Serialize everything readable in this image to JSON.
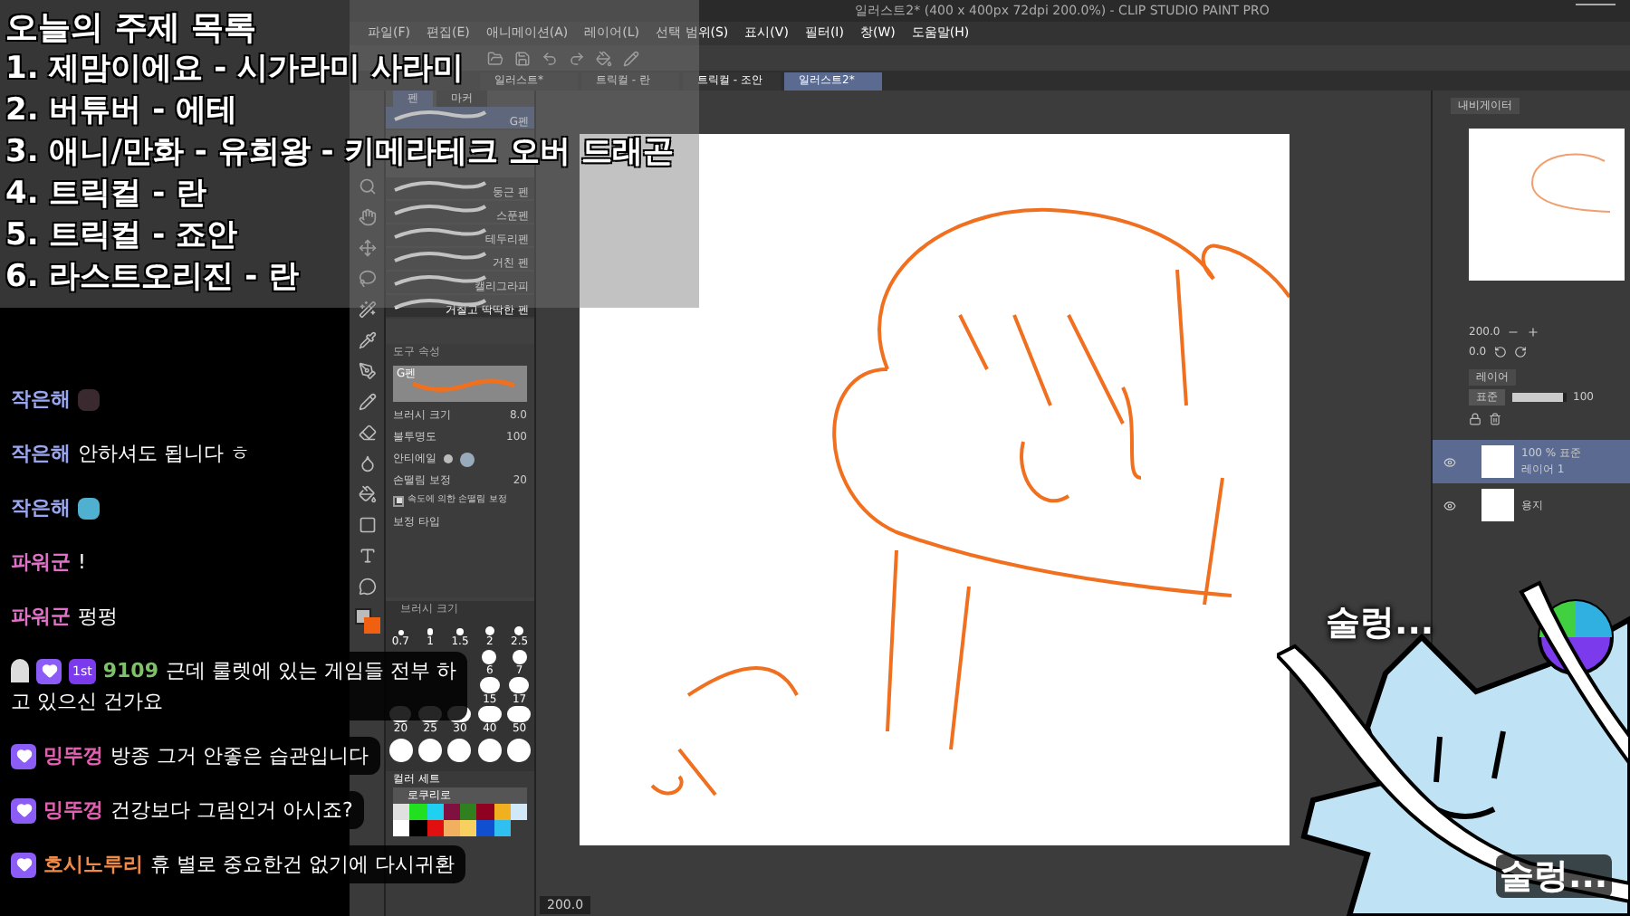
{
  "topics": {
    "title": "오늘의 주제 목록",
    "items": [
      "1.  제맘이에요 - 시가라미 사라미",
      "2. 버튜버 - 에테",
      "3. 애니/만화 - 유희왕 - 키메라테크 오버 드래곤",
      "4. 트릭컬 - 란",
      "5. 트릭컬 - 죠안",
      "6. 라스트오리진 - 란"
    ]
  },
  "app": {
    "title": "일러스트2* (400 x 400px 72dpi 200.0%) - CLIP STUDIO PAINT PRO",
    "menu": [
      "파일(F)",
      "편집(E)",
      "애니메이션(A)",
      "레이어(L)",
      "선택 범위(S)",
      "표시(V)",
      "필터(I)",
      "창(W)",
      "도움말(H)"
    ],
    "doc_tabs": [
      {
        "label": "일러스트*",
        "selected": false
      },
      {
        "label": "트릭컬 - 란",
        "selected": false
      },
      {
        "label": "트릭컬 - 조안",
        "selected": false
      },
      {
        "label": "일러스트2*",
        "selected": true
      }
    ],
    "subtool_tabs": [
      {
        "label": "펜",
        "selected": true
      },
      {
        "label": "마커",
        "selected": false
      }
    ],
    "brushes": [
      {
        "name": "G펜",
        "selected": true
      },
      {
        "name": "둥근 펜",
        "selected": false
      },
      {
        "name": "스푼펜",
        "selected": false
      },
      {
        "name": "테두리펜",
        "selected": false
      },
      {
        "name": "거친 펜",
        "selected": false
      },
      {
        "name": "캘리그라피",
        "selected": false
      },
      {
        "name": "거칠고 딱딱한 펜",
        "selected": false
      }
    ],
    "tool_property": {
      "title": "도구 속성",
      "preview_label": "G펜",
      "brush_size": {
        "label": "브러시 크기",
        "value": "8.0"
      },
      "opacity": {
        "label": "불투명도",
        "value": "100"
      },
      "anti_alias_label": "안티에일",
      "stabilization": {
        "label": "손떨림 보정",
        "value": "20"
      },
      "speed_stabilization": {
        "label": "속도에 의한 손떨림 보정",
        "checked": true
      },
      "correction_type_label": "보정 타입"
    },
    "brush_size_panel": {
      "title": "브러시 크기",
      "sizes": [
        {
          "kind": "shown",
          "label": "0.7"
        },
        {
          "kind": "shown",
          "label": "1"
        },
        {
          "kind": "shown",
          "label": "1.5"
        },
        {
          "kind": "shown",
          "label": "2"
        },
        {
          "kind": "shown",
          "label": "2.5"
        },
        {
          "kind": "covered"
        },
        {
          "kind": "covered"
        },
        {
          "kind": "covered"
        },
        {
          "kind": "shown",
          "label": "6"
        },
        {
          "kind": "shown",
          "label": "7"
        },
        {
          "kind": "covered"
        },
        {
          "kind": "covered"
        },
        {
          "kind": "covered"
        },
        {
          "kind": "shown",
          "label": "15"
        },
        {
          "kind": "shown",
          "label": "17"
        },
        {
          "kind": "shown",
          "label": "20"
        },
        {
          "kind": "shown",
          "label": "25"
        },
        {
          "kind": "shown",
          "label": "30"
        },
        {
          "kind": "shown",
          "label": "40"
        },
        {
          "kind": "shown",
          "label": "50"
        }
      ]
    },
    "color_set": {
      "title": "컬러 세트",
      "set_name": "로쿠리로",
      "swatches": [
        {
          "color": "#e0e0e0"
        },
        {
          "color": "#20e020"
        },
        {
          "color": "#20d0f0"
        },
        {
          "color": "#801040"
        },
        {
          "color": "#308020"
        },
        {
          "color": "#900020"
        },
        {
          "color": "#f0b020"
        },
        {
          "color": "#d0e8f8"
        },
        {
          "color": "#ffffff"
        },
        {
          "color": "#000000"
        },
        {
          "color": "#e01010"
        },
        {
          "color": "#f0b060"
        },
        {
          "color": "#f8d060"
        },
        {
          "color": "#1050d0"
        },
        {
          "color": "#30c0f0"
        }
      ]
    },
    "zoom_reading": "200.0",
    "navigator": {
      "tab": "내비게이터",
      "zoom": "200.0",
      "angle": "0.0"
    },
    "layers": {
      "tab": "레이어",
      "blend": "표준",
      "opacity": "100",
      "opacity_slider": {
        "level": 0.95
      },
      "items": [
        {
          "mode": "100 % 표준",
          "name": "레이어 1",
          "selected": true
        },
        {
          "name": "용지",
          "selected": false
        }
      ]
    }
  },
  "chat": [
    {
      "user": "작은해",
      "color": "#9aa6ee",
      "emote": true,
      "faded": true
    },
    {
      "user": "작은해",
      "color": "#9aa6ee",
      "text": "안하셔도 됩니다 ㅎ",
      "emote": false,
      "faded": false
    },
    {
      "user": "작은해",
      "color": "#9aa6ee",
      "emote": true,
      "faded": false
    },
    {
      "user": "파워군",
      "color": "#e070c8",
      "text": "!",
      "emote": false,
      "faded": false
    },
    {
      "user": "파워군",
      "color": "#e070c8",
      "text": "펑펑",
      "emote": false,
      "faded": false
    },
    {
      "user": "9109",
      "color": "#7fc06a",
      "text": "근데 룰렛에 있는 게임들 전부 하고 있으신 건가요",
      "emote": false,
      "faded": false,
      "badges": [
        {
          "kind": "figure"
        },
        {
          "kind": "heart"
        },
        {
          "kind": "tier",
          "label": "1st"
        }
      ]
    },
    {
      "user": "밍뚜껑",
      "color": "#e060b0",
      "text": "방종 그거 안좋은 습관입니다",
      "emote": false,
      "faded": false,
      "badges": [
        {
          "kind": "heart"
        }
      ]
    },
    {
      "user": "밍뚜껑",
      "color": "#e060b0",
      "text": "건강보다 그림인거 아시죠?",
      "emote": false,
      "faded": false,
      "badges": [
        {
          "kind": "heart"
        }
      ]
    },
    {
      "user": "호시노루리",
      "color": "#f08a48",
      "text": "휴 별로 중요한건 없기에 다시귀환",
      "emote": false,
      "faded": false,
      "badges": [
        {
          "kind": "heart"
        }
      ]
    }
  ],
  "mascot": {
    "captions": [
      "술렁...",
      "술렁..."
    ]
  }
}
